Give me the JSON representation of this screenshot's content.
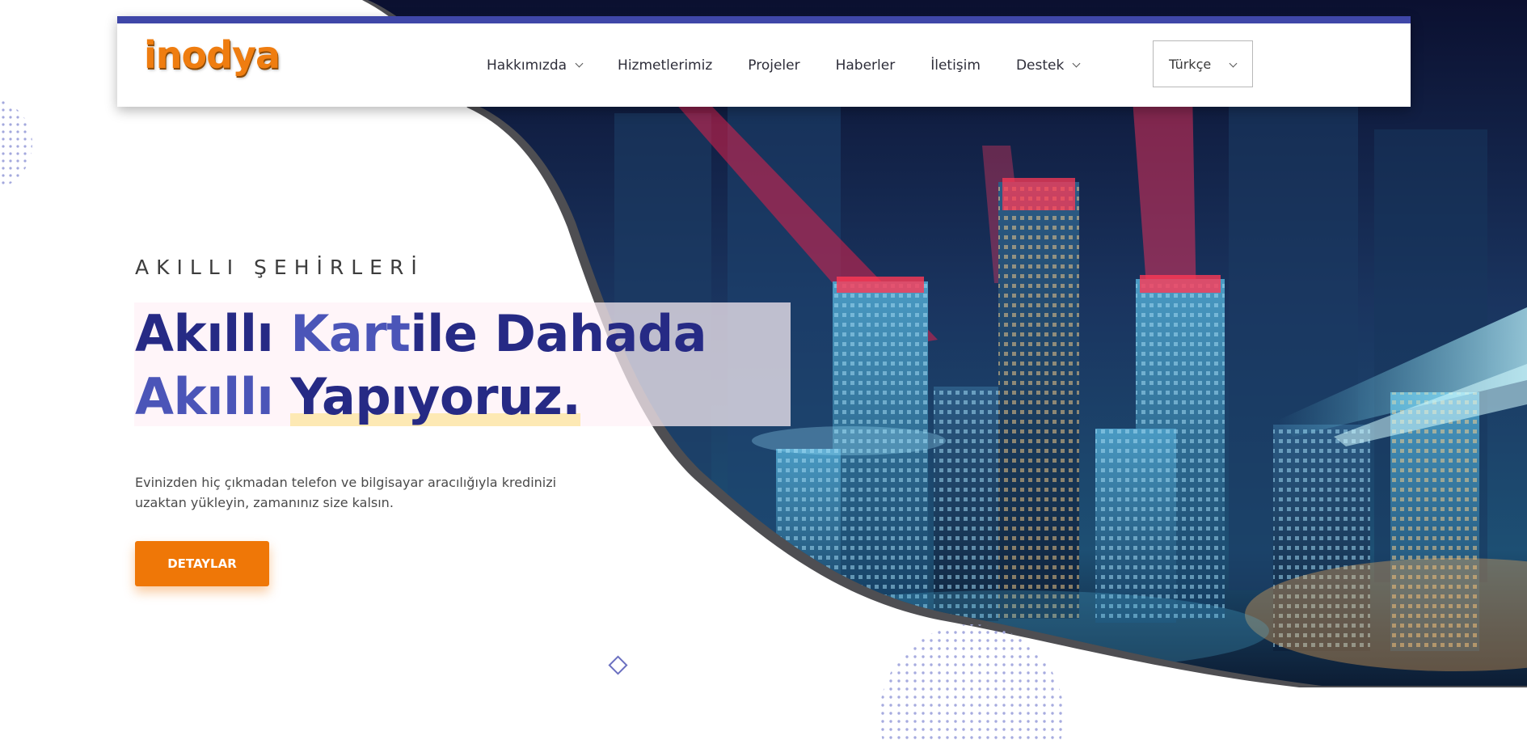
{
  "header": {
    "logo_text": "inodya",
    "nav": [
      {
        "label": "Hakkımızda",
        "has_dropdown": true
      },
      {
        "label": "Hizmetlerimiz",
        "has_dropdown": false
      },
      {
        "label": "Projeler",
        "has_dropdown": false
      },
      {
        "label": "Haberler",
        "has_dropdown": false
      },
      {
        "label": "İletişim",
        "has_dropdown": false
      },
      {
        "label": "Destek",
        "has_dropdown": true
      }
    ],
    "language_selected": "Türkçe"
  },
  "hero": {
    "eyebrow": "AKILLI ŞEHİRLERİ",
    "headline": {
      "part1": "Akıllı ",
      "part2": "Kart",
      "part3": "ile Dahada",
      "part4": "Akıllı ",
      "part5": "Yapıyoruz."
    },
    "description": "Evinizden hiç çıkmadan telefon ve bilgisayar aracılığıyla kredinizi uzaktan yükleyin, zamanınız size kalsın.",
    "cta_label": "DETAYLAR"
  },
  "colors": {
    "accent_orange": "#ef7707",
    "brand_dark_blue": "#262a85",
    "brand_light_blue": "#4b55b8",
    "header_top_border": "#3f47a8"
  }
}
